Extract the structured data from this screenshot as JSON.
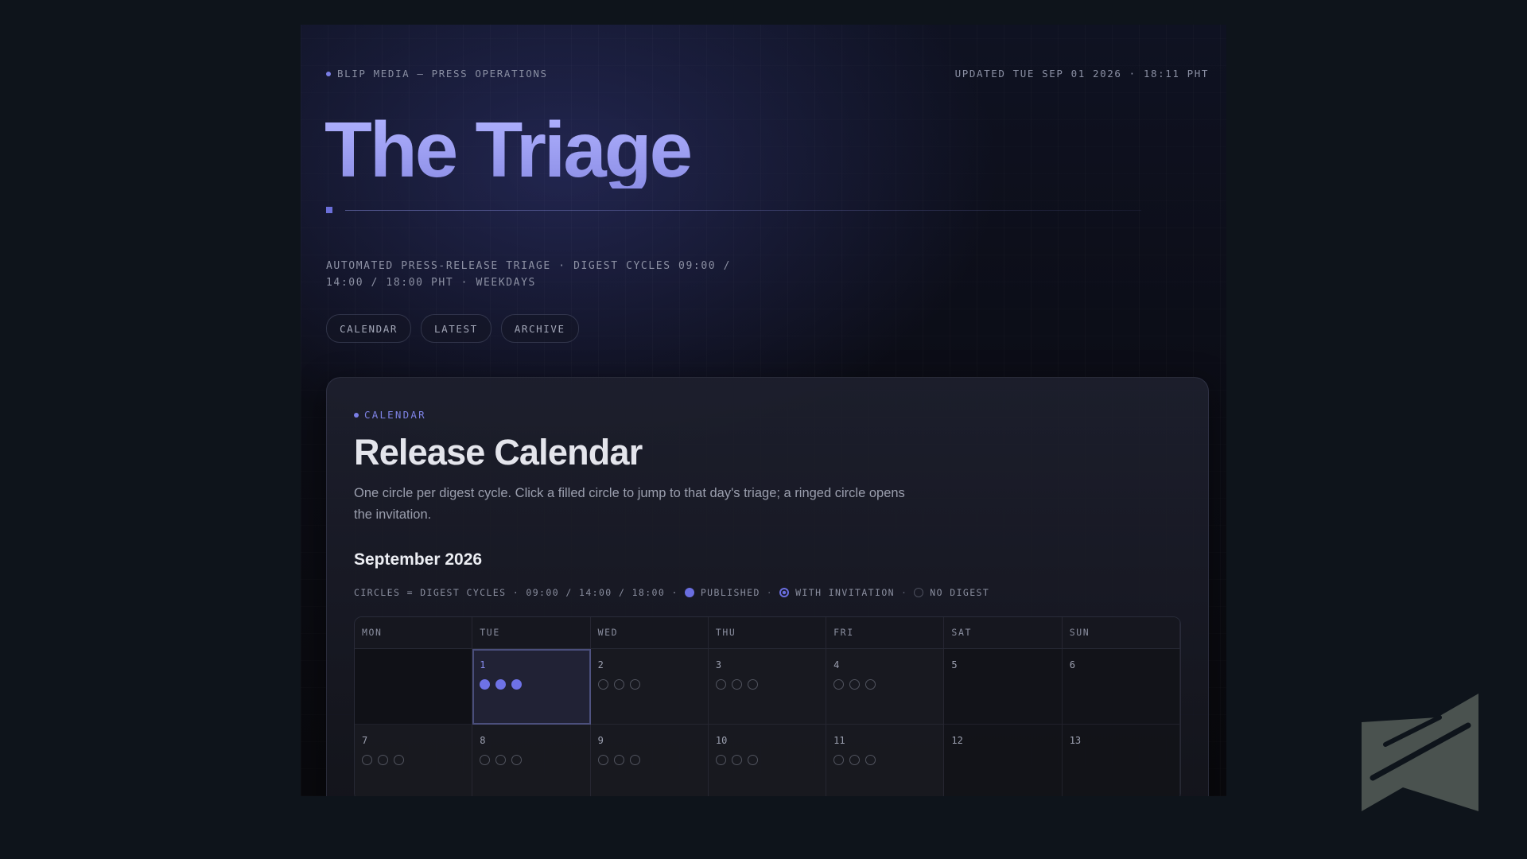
{
  "topbar": {
    "brand": "BLIP MEDIA — PRESS OPERATIONS",
    "updated": "UPDATED TUE SEP 01 2026 · 18:11 PHT"
  },
  "hero": {
    "title": "The Triage",
    "subtitle": "AUTOMATED PRESS-RELEASE TRIAGE  ·  DIGEST CYCLES 09:00 / 14:00 / 18:00 PHT  ·  WEEKDAYS"
  },
  "nav": [
    {
      "label": "CALENDAR"
    },
    {
      "label": "LATEST"
    },
    {
      "label": "ARCHIVE"
    }
  ],
  "calendar": {
    "eyebrow": "CALENDAR",
    "title": "Release Calendar",
    "description": "One circle per digest cycle. Click a filled circle to jump to that day's triage; a ringed circle opens the invitation.",
    "month": "September 2026",
    "legend": {
      "cycles": "CIRCLES = DIGEST CYCLES · 09:00 / 14:00 / 18:00 ·",
      "published": "PUBLISHED",
      "with_invitation": "WITH INVITATION",
      "no_digest": "NO DIGEST",
      "sep": "·"
    },
    "weekdays": [
      "MON",
      "TUE",
      "WED",
      "THU",
      "FRI",
      "SAT",
      "SUN"
    ],
    "weeks": [
      [
        {
          "day": "",
          "cycles": []
        },
        {
          "day": "1",
          "cycles": [
            "published",
            "published",
            "published"
          ],
          "today": true
        },
        {
          "day": "2",
          "cycles": [
            "none",
            "none",
            "none"
          ]
        },
        {
          "day": "3",
          "cycles": [
            "none",
            "none",
            "none"
          ]
        },
        {
          "day": "4",
          "cycles": [
            "none",
            "none",
            "none"
          ]
        },
        {
          "day": "5",
          "cycles": [],
          "weekend": true
        },
        {
          "day": "6",
          "cycles": [],
          "weekend": true
        }
      ],
      [
        {
          "day": "7",
          "cycles": [
            "none",
            "none",
            "none"
          ]
        },
        {
          "day": "8",
          "cycles": [
            "none",
            "none",
            "none"
          ]
        },
        {
          "day": "9",
          "cycles": [
            "none",
            "none",
            "none"
          ]
        },
        {
          "day": "10",
          "cycles": [
            "none",
            "none",
            "none"
          ]
        },
        {
          "day": "11",
          "cycles": [
            "none",
            "none",
            "none"
          ]
        },
        {
          "day": "12",
          "cycles": [],
          "weekend": true
        },
        {
          "day": "13",
          "cycles": [],
          "weekend": true
        }
      ]
    ]
  },
  "colors": {
    "accent": "#6e72e6",
    "title_gradient_top": "#b0b2ff",
    "background": "#0e141b"
  },
  "icons": {
    "watermark": "logo-mark-icon"
  }
}
